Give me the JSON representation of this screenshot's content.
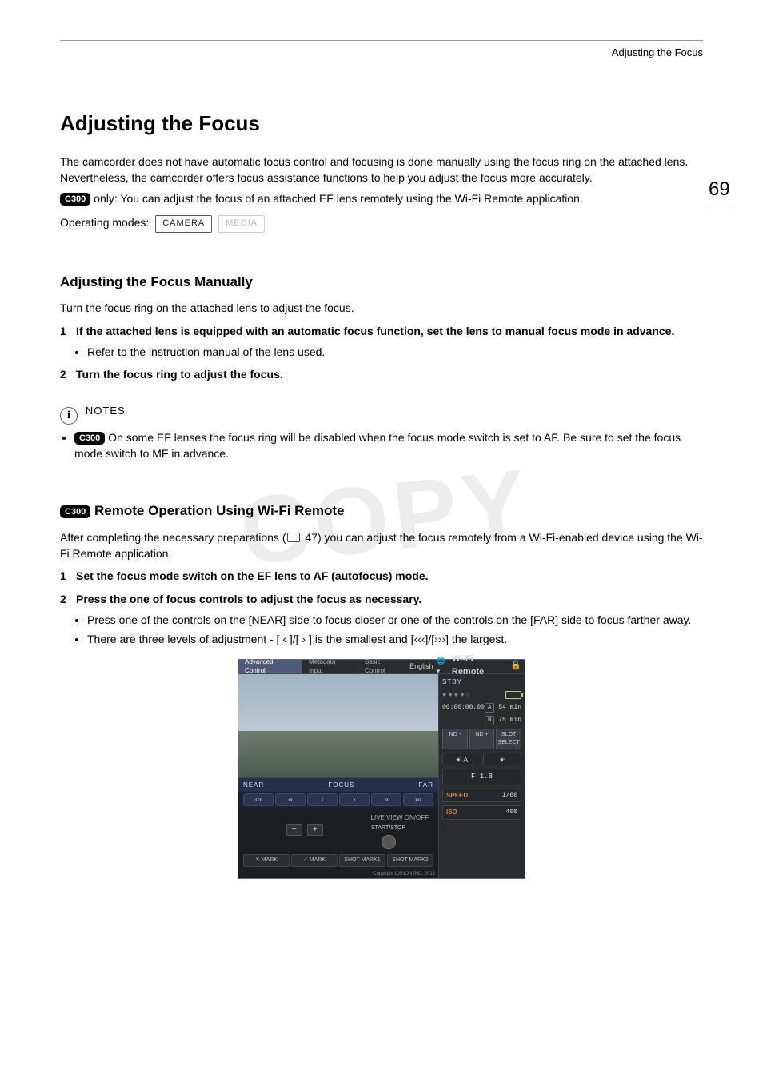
{
  "header": {
    "running_title": "Adjusting the Focus"
  },
  "page_number": "69",
  "title": "Adjusting the Focus",
  "intro": {
    "p1": "The camcorder does not have automatic focus control and focusing is done manually using the focus ring on the attached lens. Nevertheless, the camcorder offers focus assistance functions to help you adjust the focus more accurately.",
    "badge": "C300",
    "p2": " only: You can adjust the focus of an attached EF lens remotely using the Wi-Fi Remote application."
  },
  "operating_modes": {
    "label": "Operating modes:",
    "modes": [
      "CAMERA",
      "MEDIA"
    ]
  },
  "watermark": "COPY",
  "section_manual": {
    "heading": "Adjusting the Focus Manually",
    "lead": "Turn the focus ring on the attached lens to adjust the focus.",
    "steps": [
      {
        "num": "1",
        "text": "If the attached lens is equipped with an automatic focus function, set the lens to manual focus mode in advance.",
        "sub": [
          "Refer to the instruction manual of the lens used."
        ]
      },
      {
        "num": "2",
        "text": "Turn the focus ring to adjust the focus.",
        "sub": []
      }
    ],
    "notes_label": "NOTES",
    "notes_badge": "C300",
    "notes_text": " On some EF lenses the focus ring will be disabled when the focus mode switch is set to AF. Be sure to set the focus mode switch to MF in advance."
  },
  "section_remote": {
    "badge": "C300",
    "heading": " Remote Operation Using Wi-Fi Remote",
    "lead_pre": "After completing the necessary preparations (",
    "lead_ref": " 47",
    "lead_post": ") you can adjust the focus remotely from a Wi-Fi-enabled device using the Wi-Fi Remote application.",
    "steps": [
      {
        "num": "1",
        "text": "Set the focus mode switch on the EF lens to AF (autofocus) mode.",
        "sub": []
      },
      {
        "num": "2",
        "text": "Press the one of focus controls to adjust the focus as necessary.",
        "sub": [
          "Press one of the controls on the [NEAR] side to focus closer or one of the controls on the [FAR] side to focus farther away.",
          "There are three levels of adjustment - [ ‹ ]/[ › ] is the smallest and [‹‹‹]/[›››] the largest."
        ]
      }
    ]
  },
  "wifi_ui": {
    "tabs": [
      "Advanced Control",
      "Metadata Input",
      "Basic Control"
    ],
    "lang": "English",
    "title": "Wi-Fi Remote",
    "near": "NEAR",
    "focus": "FOCUS",
    "far": "FAR",
    "arrows": [
      "‹‹‹",
      "‹‹",
      "‹",
      "›",
      "››",
      "›››"
    ],
    "live": "LIVE VIEW ON/OFF",
    "startstop": "START/STOP",
    "marks": [
      "✕ MARK",
      "✓ MARK",
      "SHOT MARK1",
      "SHOT MARK2"
    ],
    "stby": "STBY",
    "timecode": "00:00:00.00",
    "media": [
      {
        "slot": "A",
        "time": "54 min"
      },
      {
        "slot": "B",
        "time": "75 min"
      }
    ],
    "nd_minus": "ND -",
    "nd_plus": "ND +",
    "slot_select": "SLOT SELECT",
    "wb": "A",
    "fstop": "F 1.8",
    "params": [
      {
        "label": "SPEED",
        "value": "1/60"
      },
      {
        "label": "ISO",
        "value": "400"
      }
    ],
    "copyright": "Copyright CANON INC. 2012"
  }
}
